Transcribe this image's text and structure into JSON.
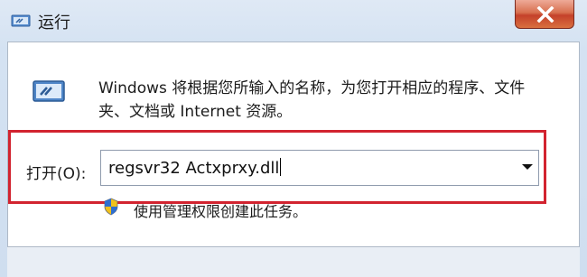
{
  "window": {
    "title": "运行",
    "close_symbol": "X"
  },
  "dialog": {
    "description": "Windows 将根据您所输入的名称，为您打开相应的程序、文件夹、文档或 Internet 资源。",
    "open_label": "打开(O):",
    "command_value": "regsvr32 Actxprxy.dll",
    "admin_note": "使用管理权限创建此任务。"
  },
  "icons": {
    "title": "run-icon",
    "main": "run-large-icon",
    "shield": "uac-shield-icon",
    "dropdown": "chevron-down-icon",
    "close": "close-icon"
  },
  "colors": {
    "highlight_border": "#d2232f",
    "close_button": "#c4412a",
    "window_frame": "#cfdeef"
  }
}
